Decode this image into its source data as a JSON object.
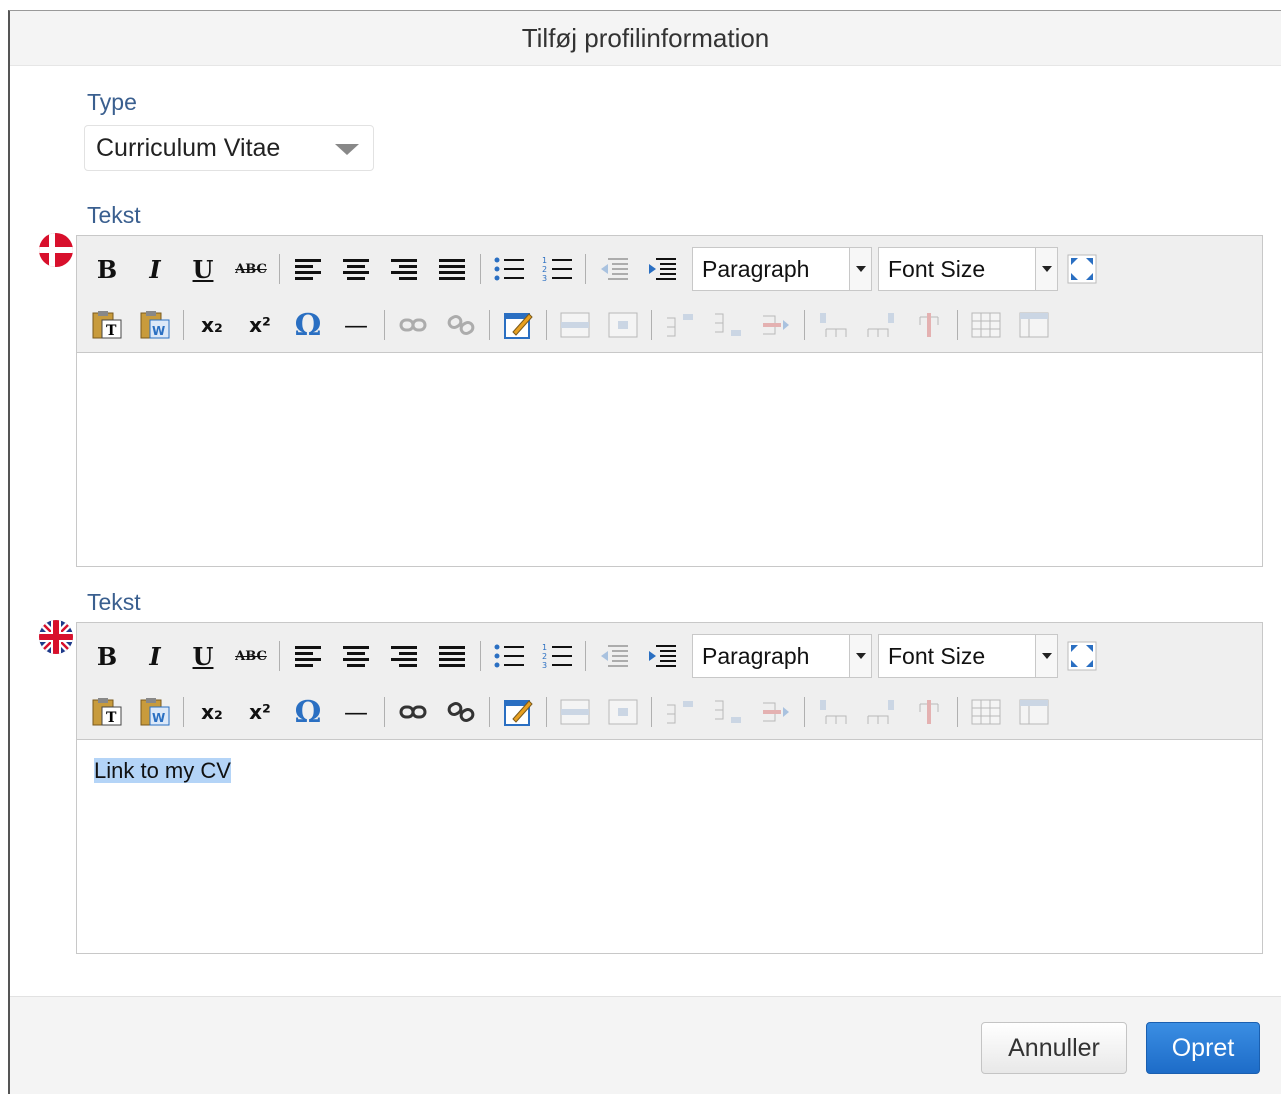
{
  "dialog": {
    "title": "Tilføj profilinformation"
  },
  "type_field": {
    "label": "Type",
    "selected": "Curriculum Vitae"
  },
  "editors": [
    {
      "label": "Tekst",
      "language_icon": "danish-flag-icon",
      "content": "",
      "format_select": "Paragraph",
      "font_size_select": "Font Size"
    },
    {
      "label": "Tekst",
      "language_icon": "british-flag-icon",
      "content": "Link to my CV",
      "format_select": "Paragraph",
      "font_size_select": "Font Size"
    }
  ],
  "toolbar": {
    "bold": "B",
    "italic": "I",
    "underline": "U",
    "strikethrough": "ABC",
    "subscript": "x₂",
    "superscript": "x²",
    "omega": "Ω",
    "hr": "—"
  },
  "footer": {
    "cancel": "Annuller",
    "create": "Opret"
  },
  "colors": {
    "label": "#3a5f8f",
    "primary": "#2a7ad7",
    "selection": "#b4d4f7"
  }
}
